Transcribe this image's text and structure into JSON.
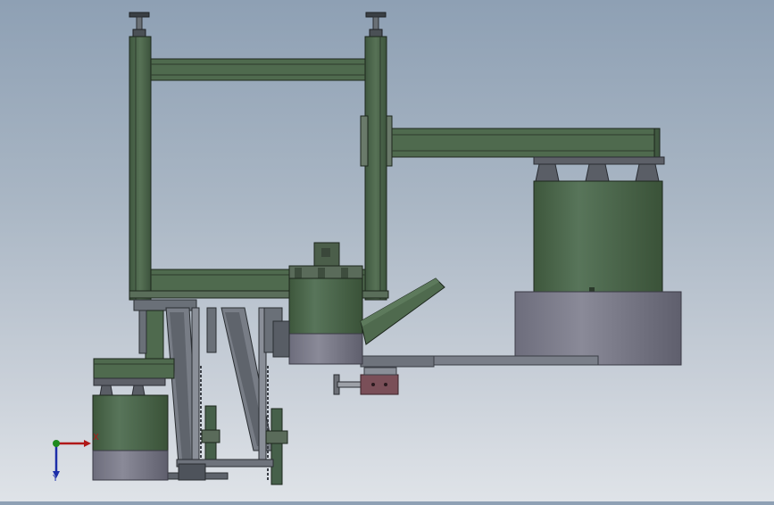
{
  "app": {
    "title": "",
    "view": "Front"
  },
  "triad": {
    "x_label": "X",
    "y_label": "Y",
    "x_color": "#b01818",
    "y_color": "#1c2ea8",
    "z_color": "#1e8a1e"
  },
  "colors": {
    "frame_green": "#4f6a4e",
    "frame_green_dark": "#2f412f",
    "frame_edge": "#1c261c",
    "tank_green": "#4d6a4b",
    "base_grey": "#7d7d8c",
    "base_grey_dark": "#5e5e6c",
    "steel": "#6c7078",
    "maroon": "#7a4f58",
    "sky_top": "#8ea0b4",
    "sky_bottom": "#dfe3e8"
  },
  "model": {
    "description_parts": [
      "frame-left-column",
      "frame-right-column",
      "frame-top-beam",
      "frame-bottom-beam",
      "side-arm-beam",
      "right-tank",
      "right-tank-base",
      "center-hopper",
      "chute",
      "left-tank",
      "left-tank-base",
      "cylinder-actuator",
      "guide-rails",
      "leveling-feet"
    ]
  }
}
